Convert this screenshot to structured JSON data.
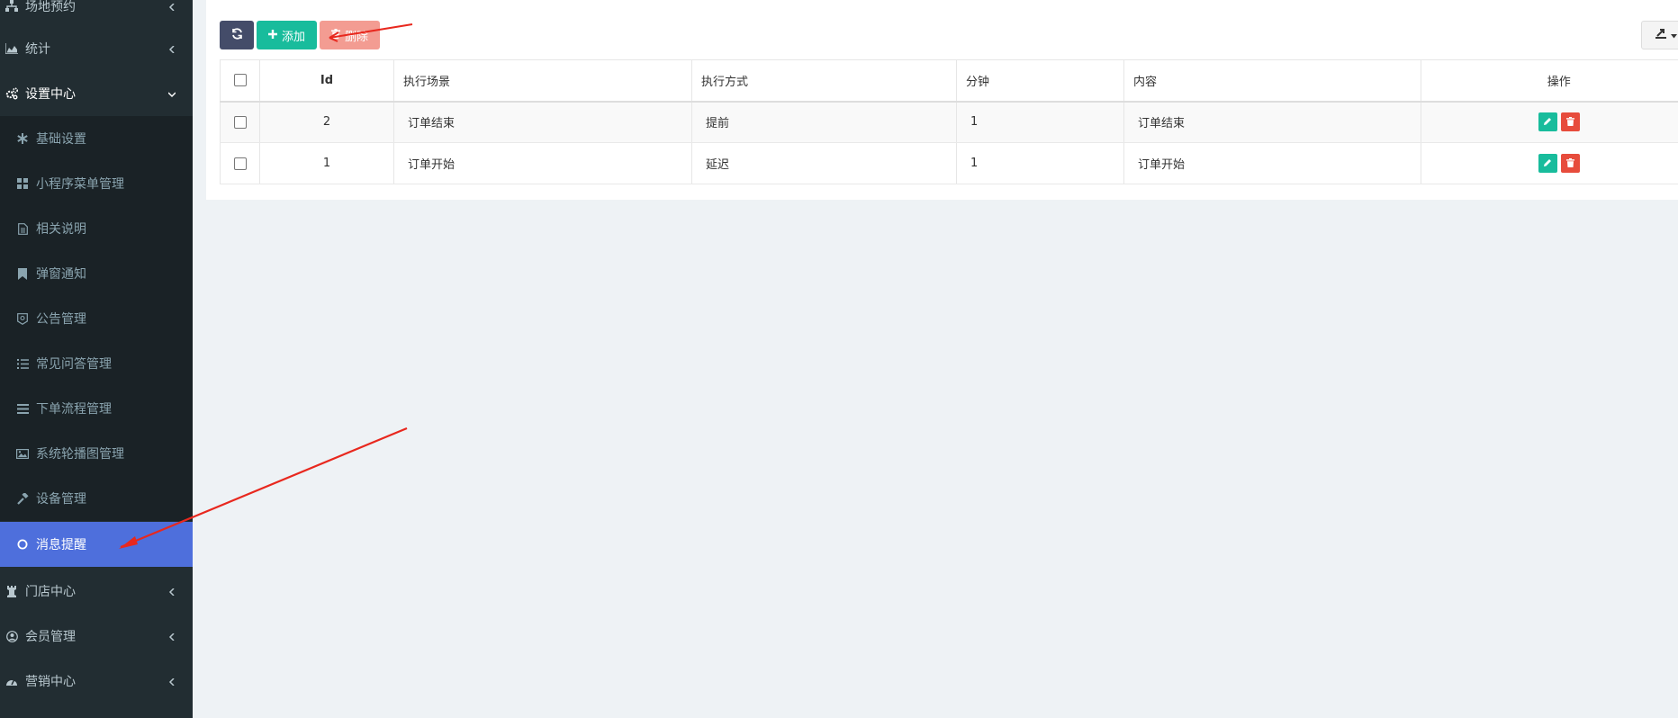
{
  "sidebar": {
    "items": [
      {
        "label": "场地预约",
        "icon": "sitemap-icon",
        "type": "top"
      },
      {
        "label": "统计",
        "icon": "area-chart-icon",
        "type": "top"
      },
      {
        "label": "设置中心",
        "icon": "cogs-icon",
        "type": "top-open"
      },
      {
        "label": "基础设置",
        "icon": "asterisk-icon",
        "type": "sub"
      },
      {
        "label": "小程序菜单管理",
        "icon": "th-large-icon",
        "type": "sub"
      },
      {
        "label": "相关说明",
        "icon": "file-text-icon",
        "type": "sub"
      },
      {
        "label": "弹窗通知",
        "icon": "bookmark-icon",
        "type": "sub"
      },
      {
        "label": "公告管理",
        "icon": "badge-icon",
        "type": "sub"
      },
      {
        "label": "常见问答管理",
        "icon": "list-icon",
        "type": "sub"
      },
      {
        "label": "下单流程管理",
        "icon": "bars-icon",
        "type": "sub"
      },
      {
        "label": "系统轮播图管理",
        "icon": "image-icon",
        "type": "sub"
      },
      {
        "label": "设备管理",
        "icon": "gavel-icon",
        "type": "sub"
      },
      {
        "label": "消息提醒",
        "icon": "circle-o-icon",
        "type": "sub-active"
      },
      {
        "label": "门店中心",
        "icon": "chess-rook-icon",
        "type": "top"
      },
      {
        "label": "会员管理",
        "icon": "user-circle-icon",
        "type": "top"
      },
      {
        "label": "营销中心",
        "icon": "dashboard-icon",
        "type": "top"
      }
    ]
  },
  "toolbar": {
    "add_label": "添加",
    "delete_label": "删除"
  },
  "table": {
    "headers": [
      "Id",
      "执行场景",
      "执行方式",
      "分钟",
      "内容",
      "操作"
    ],
    "rows": [
      {
        "id": "2",
        "scene": "订单结束",
        "mode": "提前",
        "minutes": "1",
        "content": "订单结束"
      },
      {
        "id": "1",
        "scene": "订单开始",
        "mode": "延迟",
        "minutes": "1",
        "content": "订单开始"
      }
    ]
  },
  "colors": {
    "sidebar_bg": "#222d32",
    "sidebar_active": "#4e6fdc",
    "add_btn": "#18bc9c",
    "delete_btn": "#f39c92",
    "refresh_btn": "#444c69",
    "edit_op": "#18bc9c",
    "delete_op": "#e74c3c",
    "annotation_arrow": "#e8281e"
  }
}
